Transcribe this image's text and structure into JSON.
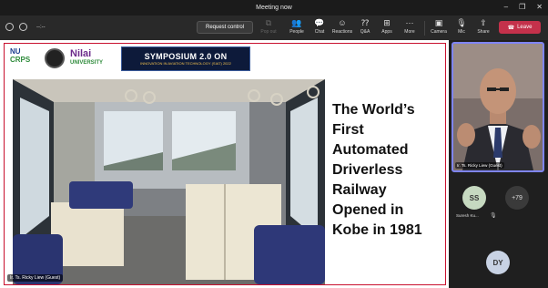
{
  "window": {
    "title": "Meeting now",
    "controls": [
      "–",
      "❐",
      "✕"
    ]
  },
  "toolbar": {
    "timer": "--:--",
    "request_control": "Request control",
    "items": [
      {
        "key": "popout",
        "label": "Pop out",
        "icon": "popout-icon",
        "glyph": "⧉",
        "enabled": false
      },
      {
        "key": "people",
        "label": "People",
        "icon": "people-icon",
        "glyph": "👥",
        "enabled": true
      },
      {
        "key": "chat",
        "label": "Chat",
        "icon": "chat-icon",
        "glyph": "💬",
        "enabled": true
      },
      {
        "key": "reactions",
        "label": "Reactions",
        "icon": "reactions-icon",
        "glyph": "☺",
        "enabled": true
      },
      {
        "key": "qa",
        "label": "Q&A",
        "icon": "qa-icon",
        "glyph": "⁇",
        "enabled": true
      },
      {
        "key": "apps",
        "label": "Apps",
        "icon": "apps-icon",
        "glyph": "⊞",
        "enabled": true
      },
      {
        "key": "more",
        "label": "More",
        "icon": "more-icon",
        "glyph": "···",
        "enabled": true
      },
      {
        "key": "camera",
        "label": "Camera",
        "icon": "camera-icon",
        "glyph": "▣",
        "enabled": true
      },
      {
        "key": "mic",
        "label": "Mic",
        "icon": "mic-icon",
        "glyph": "🎙",
        "enabled": true
      },
      {
        "key": "share",
        "label": "Share",
        "icon": "share-icon",
        "glyph": "⇪",
        "enabled": true
      }
    ],
    "leave_label": "Leave",
    "leave_color": "#c4314b"
  },
  "stage": {
    "logo_text_1": "NU",
    "logo_text_1b": "CRPS",
    "logo_text_3": "Nilai",
    "logo_text_3b": "UNIVERSITY",
    "symposium_title": "SYMPOSIUM 2.0 ON",
    "symposium_sub": "INNOVATION IN AVIATION TECHNOLOGY (SIAT) 2022",
    "headline": "The World’s First Automated Driverless Railway Opened in Kobe in 1981",
    "presenter_label": "Ir. Ts. Ricky Liew (Guest)"
  },
  "side": {
    "video_name": "Ir. Ts. Ricky Liew (Guest)",
    "participants": [
      {
        "initials": "SS",
        "name": "Suresh Ku..."
      },
      {
        "initials": "+79",
        "name": ""
      },
      {
        "initials": "DY",
        "name": ""
      }
    ],
    "accent_color": "#7f85f5"
  }
}
